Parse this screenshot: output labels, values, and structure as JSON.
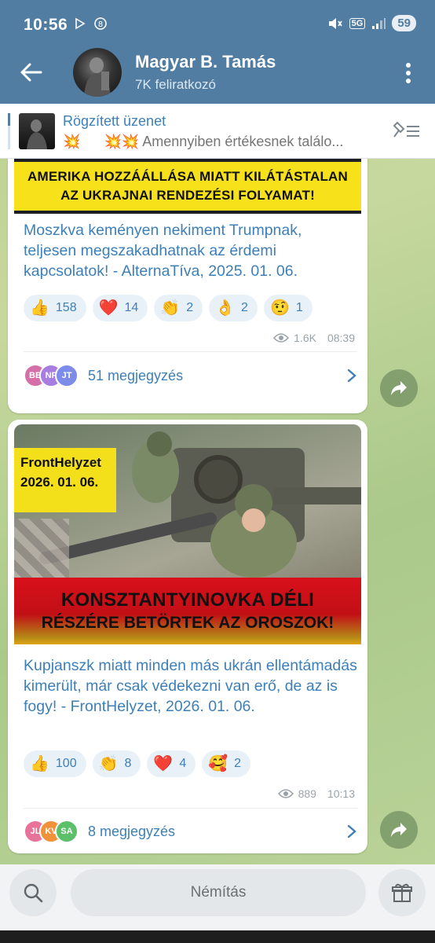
{
  "status_bar": {
    "time": "10:56",
    "battery": "59",
    "network": "5G"
  },
  "header": {
    "title": "Magyar B. Tamás",
    "subtitle": "7K feliratkozó"
  },
  "pinned": {
    "title": "Rögzített üzenet",
    "text": "Amennyiben értékesnek találo..."
  },
  "messages": [
    {
      "image_text": [
        "AMERIKA HOZZÁÁLLÁSA MIATT KILÁTÁSTALAN",
        "AZ UKRAJNAI RENDEZÉSI FOLYAMAT!"
      ],
      "text": "Moszkva keményen nekiment Trumpnak, teljesen megszakadhatnak az érdemi kapcsolatok! - AlternaTíva, 2025. 01. 06.",
      "reactions": [
        {
          "icon": "thumbs-up-icon",
          "emoji": "👍",
          "count": "158"
        },
        {
          "icon": "red-heart-icon",
          "emoji": "❤️",
          "count": "14"
        },
        {
          "icon": "clapping-hands-icon",
          "emoji": "👏",
          "count": "2"
        },
        {
          "icon": "ok-hand-icon",
          "emoji": "👌",
          "count": "2"
        },
        {
          "icon": "raised-eyebrow-face-icon",
          "emoji": "🤨",
          "count": "1"
        }
      ],
      "views": "1.6K",
      "time": "08:39",
      "comment_avatars": [
        {
          "initials": "BB",
          "color": "#d46fa8"
        },
        {
          "initials": "NF",
          "color": "#a87de0"
        },
        {
          "initials": "JT",
          "color": "#7c8ce8"
        }
      ],
      "comments_label": "51 megjegyzés"
    },
    {
      "image_text": {
        "tag_line1": "FrontHelyzet",
        "tag_line2": "2026. 01. 06.",
        "banner_line1": "KONSZTANTYINOVKA DÉLI",
        "banner_line2": "RÉSZÉRE BETÖRTEK AZ OROSZOK!"
      },
      "text": "Kupjanszk miatt minden más ukrán ellentámadás kimerült, már csak védekezni van erő, de az is fogy! - FrontHelyzet, 2026. 01. 06.",
      "reactions": [
        {
          "icon": "thumbs-up-icon",
          "emoji": "👍",
          "count": "100"
        },
        {
          "icon": "clapping-hands-icon",
          "emoji": "👏",
          "count": "8"
        },
        {
          "icon": "red-heart-icon",
          "emoji": "❤️",
          "count": "4"
        },
        {
          "icon": "smiling-face-with-hearts-icon",
          "emoji": "🥰",
          "count": "2"
        }
      ],
      "views": "889",
      "time": "10:13",
      "comment_avatars": [
        {
          "initials": "JL",
          "color": "#e8739a"
        },
        {
          "initials": "KV",
          "color": "#f0923a"
        },
        {
          "initials": "SA",
          "color": "#5cbf6a"
        }
      ],
      "comments_label": "8 megjegyzés"
    }
  ],
  "bottom": {
    "mute_label": "Némítás"
  },
  "colors": {
    "header": "#517da2",
    "accent": "#3d7fb8",
    "reaction_bg": "#e9f1f8"
  }
}
